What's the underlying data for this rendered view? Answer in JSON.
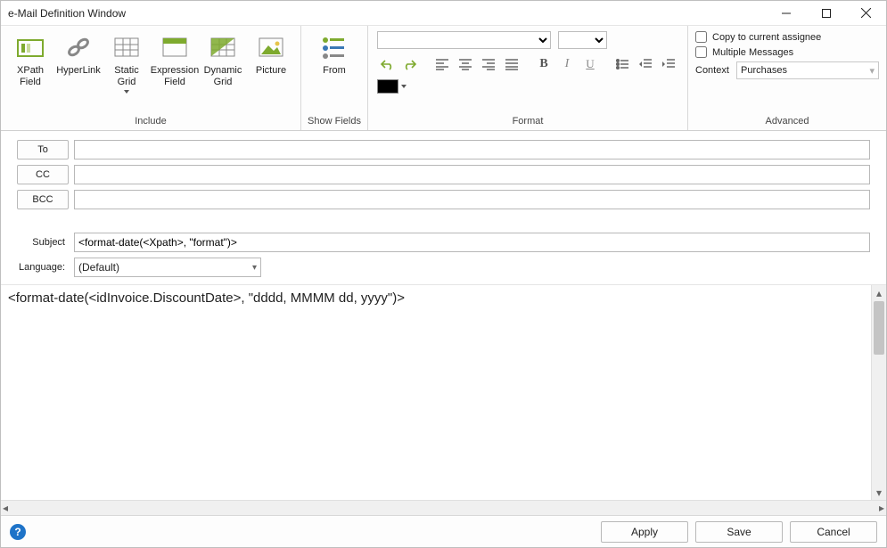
{
  "window": {
    "title": "e-Mail Definition Window"
  },
  "ribbon": {
    "include": {
      "label": "Include",
      "xpath_field": "XPath Field",
      "hyperlink": "HyperLink",
      "static_grid": "Static Grid",
      "expression_field": "Expression Field",
      "dynamic_grid": "Dynamic Grid",
      "picture": "Picture"
    },
    "show_fields": {
      "label": "Show Fields",
      "from": "From"
    },
    "format": {
      "label": "Format",
      "font_family": "",
      "font_size": "",
      "color": "#000000"
    },
    "advanced": {
      "label": "Advanced",
      "copy_to_assignee": "Copy to current assignee",
      "multiple_messages": "Multiple Messages",
      "context_label": "Context",
      "context_value": "Purchases"
    }
  },
  "fields": {
    "to_label": "To",
    "to_value": "",
    "cc_label": "CC",
    "cc_value": "",
    "bcc_label": "BCC",
    "bcc_value": "",
    "subject_label": "Subject",
    "subject_value": "<format-date(<Xpath>, \"format\")>",
    "language_label": "Language:",
    "language_value": "(Default)"
  },
  "body": "<format-date(<idInvoice.DiscountDate>, \"dddd, MMMM dd, yyyy\")>",
  "footer": {
    "apply": "Apply",
    "save": "Save",
    "cancel": "Cancel"
  }
}
